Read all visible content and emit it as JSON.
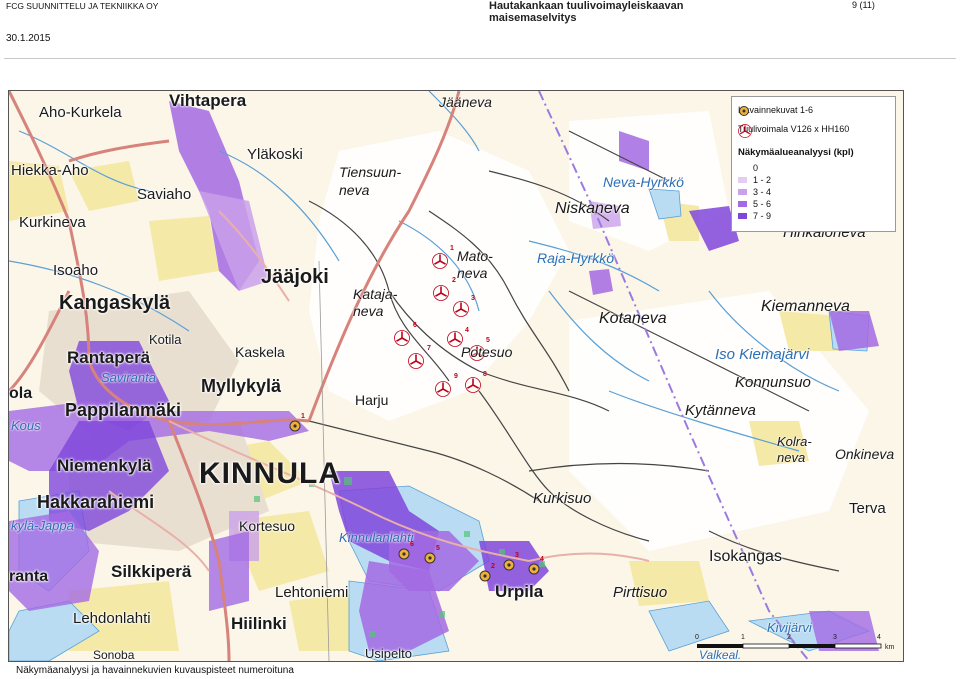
{
  "header": {
    "company": "FCG SUUNNITTELU JA TEKNIIKKA OY",
    "title_line1": "Hautakankaan tuulivoimayleiskaavan",
    "title_line2": "maisemaselvitys",
    "page": "9 (11)",
    "date": "30.1.2015"
  },
  "legend": {
    "photos_label": "Havainnekuvat 1-6",
    "turbines_label": "Tuulivoimala V126 x HH160",
    "analysis_title": "Näkymäalueanalyysi (kpl)",
    "classes": [
      {
        "label": "0",
        "color": "#ffffff"
      },
      {
        "label": "1 - 2",
        "color": "#e3cdf0"
      },
      {
        "label": "3 - 4",
        "color": "#c9a0ea"
      },
      {
        "label": "5 - 6",
        "color": "#a36ae3"
      },
      {
        "label": "7 - 9",
        "color": "#8046dc"
      }
    ]
  },
  "places": [
    {
      "id": "vihtapera",
      "text": "Vihtapera",
      "size": 17
    },
    {
      "id": "aho-kurkela",
      "text": "Aho-Kurkela",
      "size": 15
    },
    {
      "id": "jaaneva",
      "text": "Jääneva",
      "size": 14
    },
    {
      "id": "ylakoski",
      "text": "Yläkoski",
      "size": 15
    },
    {
      "id": "hiekka-aho",
      "text": "Hiekka-Aho",
      "size": 15
    },
    {
      "id": "saviaho",
      "text": "Saviaho",
      "size": 15
    },
    {
      "id": "tiensuun",
      "text": "Tiensuun-",
      "size": 14
    },
    {
      "id": "neva1",
      "text": "neva",
      "size": 14
    },
    {
      "id": "kurkineva",
      "text": "Kurkineva",
      "size": 15
    },
    {
      "id": "neva-hyrkko",
      "text": "Neva-Hyrkkö",
      "size": 14
    },
    {
      "id": "niskaneva",
      "text": "Niskaneva",
      "size": 16
    },
    {
      "id": "hinkaloneva",
      "text": "Hinkaloneva",
      "size": 15
    },
    {
      "id": "isoaho",
      "text": "Isoaho",
      "size": 15
    },
    {
      "id": "jaajoki",
      "text": "Jääjoki",
      "size": 20
    },
    {
      "id": "mato",
      "text": "Mato-",
      "size": 14
    },
    {
      "id": "neva2",
      "text": "neva",
      "size": 14
    },
    {
      "id": "raja-hyrkko",
      "text": "Raja-Hyrkkö",
      "size": 14
    },
    {
      "id": "kangaskyla",
      "text": "Kangaskylä",
      "size": 20
    },
    {
      "id": "kataja",
      "text": "Kataja-",
      "size": 14
    },
    {
      "id": "neva3",
      "text": "neva",
      "size": 14
    },
    {
      "id": "kiemanneva",
      "text": "Kiemanneva",
      "size": 16
    },
    {
      "id": "kotaneva",
      "text": "Kotaneva",
      "size": 16
    },
    {
      "id": "kotila",
      "text": "Kotila",
      "size": 13
    },
    {
      "id": "rantapera",
      "text": "Rantaperä",
      "size": 17
    },
    {
      "id": "kaskela",
      "text": "Kaskela",
      "size": 14
    },
    {
      "id": "potesuo",
      "text": "Potesuo",
      "size": 14
    },
    {
      "id": "iso-kiemajarvi",
      "text": "Iso Kiemajärvi",
      "size": 15
    },
    {
      "id": "saviranta",
      "text": "Saviranta",
      "size": 13
    },
    {
      "id": "myllykyla",
      "text": "Myllykylä",
      "size": 18
    },
    {
      "id": "konnunsuo",
      "text": "Konnunsuo",
      "size": 15
    },
    {
      "id": "ola",
      "text": "ola",
      "size": 16
    },
    {
      "id": "pappilanmaki",
      "text": "Pappilanmäki",
      "size": 18
    },
    {
      "id": "harju",
      "text": "Harju",
      "size": 14
    },
    {
      "id": "kytanneva",
      "text": "Kytänneva",
      "size": 15
    },
    {
      "id": "kousi",
      "text": "Kous",
      "size": 13
    },
    {
      "id": "kolra",
      "text": "Kolra-",
      "size": 13
    },
    {
      "id": "neva4",
      "text": "neva",
      "size": 13
    },
    {
      "id": "onkineva",
      "text": "Onkineva",
      "size": 14
    },
    {
      "id": "niemenkyla",
      "text": "Niemenkylä",
      "size": 17
    },
    {
      "id": "kinnula",
      "text": "KINNULA",
      "size": 30
    },
    {
      "id": "kurkisuo",
      "text": "Kurkisuo",
      "size": 15
    },
    {
      "id": "hakkarahiemi",
      "text": "Hakkarahiemi",
      "size": 18
    },
    {
      "id": "terva",
      "text": "Terva",
      "size": 15
    },
    {
      "id": "kortesuo",
      "text": "Kortesuo",
      "size": 14
    },
    {
      "id": "kla-jappa",
      "text": "kylä-Jappa",
      "size": 13
    },
    {
      "id": "kinnulanlahti",
      "text": "Kinnulanlahti",
      "size": 13
    },
    {
      "id": "isokangas",
      "text": "Isokangas",
      "size": 16
    },
    {
      "id": "silkkipera",
      "text": "Silkkiperä",
      "size": 17
    },
    {
      "id": "urpila",
      "text": "Urpila",
      "size": 17
    },
    {
      "id": "ranta",
      "text": "ranta",
      "size": 16
    },
    {
      "id": "pirttisuo",
      "text": "Pirttisuo",
      "size": 15
    },
    {
      "id": "lehtoniemi",
      "text": "Lehtoniemi",
      "size": 15
    },
    {
      "id": "lehdonlahti",
      "text": "Lehdonlahti",
      "size": 15
    },
    {
      "id": "hiilinki",
      "text": "Hiilinki",
      "size": 17
    },
    {
      "id": "kivijarvi",
      "text": "Kivijärvi",
      "size": 13
    },
    {
      "id": "usipelto",
      "text": "Usipelto",
      "size": 13
    },
    {
      "id": "sonoba",
      "text": "Sonoba",
      "size": 12
    },
    {
      "id": "valkealahti",
      "text": "Valkeal.",
      "size": 12
    }
  ],
  "turbines": [
    "1",
    "2",
    "3",
    "4",
    "5",
    "6",
    "7",
    "8",
    "9"
  ],
  "photo_points": [
    "1",
    "2",
    "3",
    "4",
    "5",
    "6"
  ],
  "scale": {
    "ticks": [
      "0",
      "1",
      "2",
      "3",
      "4"
    ],
    "unit": "km"
  },
  "caption": "Näkymäanalyysi ja havainnekuvien kuvauspisteet numeroituna"
}
